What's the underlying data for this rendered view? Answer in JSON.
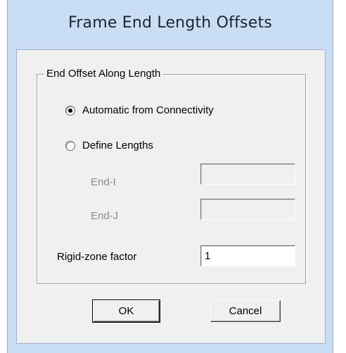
{
  "dialog": {
    "title": "Frame End Length Offsets"
  },
  "group": {
    "legend": "End Offset Along Length",
    "options": [
      {
        "label": "Automatic from Connectivity",
        "checked": true
      },
      {
        "label": "Define Lengths",
        "checked": false
      }
    ],
    "end_i": {
      "label": "End-I",
      "value": "",
      "enabled": false
    },
    "end_j": {
      "label": "End-J",
      "value": "",
      "enabled": false
    },
    "rigid_zone": {
      "label": "Rigid-zone factor",
      "value": "1"
    }
  },
  "buttons": {
    "ok": "OK",
    "cancel": "Cancel"
  }
}
